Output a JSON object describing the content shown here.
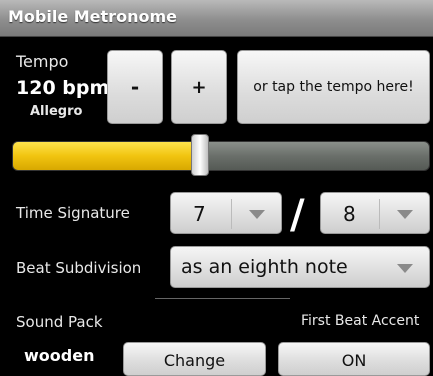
{
  "app": {
    "title": "Mobile Metronome"
  },
  "tempo": {
    "label": "Tempo",
    "value_text": "120 bpm",
    "marking": "Allegro",
    "decrement_label": "-",
    "increment_label": "+",
    "tap_label": "or tap the tempo here!",
    "slider_fraction": 0.45
  },
  "time_signature": {
    "label": "Time Signature",
    "numerator": "7",
    "divider": "/",
    "denominator": "8"
  },
  "subdivision": {
    "label": "Beat Subdivision",
    "value": "as an eighth note"
  },
  "sound_pack": {
    "label": "Sound Pack",
    "value": "wooden",
    "change_label": "Change"
  },
  "accent": {
    "label": "First Beat Accent",
    "value": "ON"
  },
  "colors": {
    "slider_fill": "#f1c410",
    "titlebar": "#8e8e8e",
    "background": "#000000"
  },
  "icons": [
    "dropdown-arrow-icon"
  ]
}
